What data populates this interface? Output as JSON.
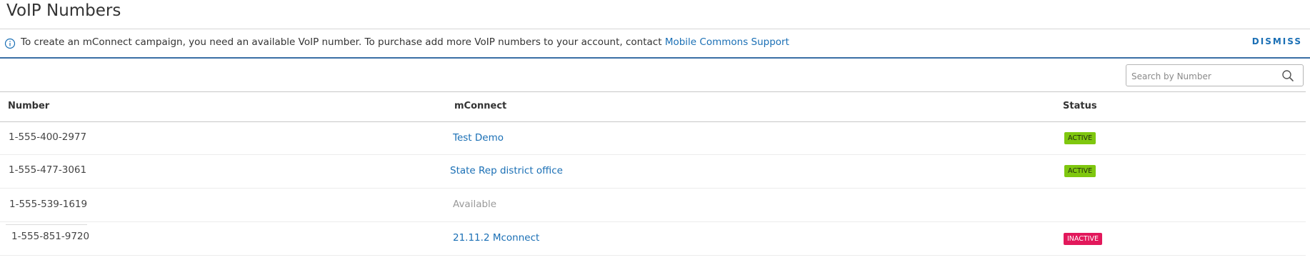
{
  "page": {
    "title": "VoIP Numbers"
  },
  "notice": {
    "text": "To create an mConnect campaign, you need an available VoIP number. To purchase add more VoIP numbers to your account, contact ",
    "link": "Mobile Commons Support",
    "dismiss": "DISMISS"
  },
  "search": {
    "placeholder": "Search by Number"
  },
  "table": {
    "headers": {
      "number": "Number",
      "mconnect": "mConnect",
      "status": "Status"
    },
    "rows": [
      {
        "number": "1-555-400-2977",
        "mconnect": "Test Demo",
        "status": "ACTIVE"
      },
      {
        "number": "1-555-477-3061",
        "mconnect": "State Rep district office",
        "status": "ACTIVE"
      },
      {
        "number": "1-555-539-1619",
        "mconnect": "Available",
        "status": ""
      },
      {
        "number": "1-555-851-9720",
        "mconnect": "21.11.2 Mconnect",
        "status": "INACTIVE"
      }
    ]
  },
  "colors": {
    "link": "#1a6fb5",
    "active_badge": "#7fc70f",
    "inactive_badge": "#e2185b",
    "notice_rule": "#3a6ea5"
  },
  "icons": {
    "info": "info-icon",
    "search": "search-icon"
  }
}
